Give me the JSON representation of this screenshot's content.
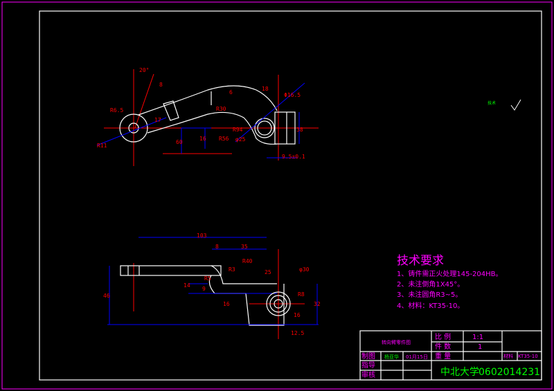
{
  "drawing": {
    "corner_note": "技术",
    "top_view_dims": [
      "20°",
      "8",
      "R6.5",
      "R11",
      "17",
      "R56",
      "R30",
      "6",
      "18",
      "R94",
      "φ25",
      "Φ16.5",
      "38",
      "60",
      "16",
      "9.5±0.1"
    ],
    "front_view_dims": [
      "103",
      "8",
      "35",
      "R40",
      "R3",
      "R5",
      "14",
      "9",
      "46",
      "16",
      "16",
      "32",
      "R8",
      "φ30",
      "25",
      "12.5"
    ]
  },
  "tech_requirements": {
    "title": "技术要求",
    "items": [
      "1、铸件需正火处理145-204HB。",
      "2、未注倒角1X45°。",
      "3、未注圆角R3~5。",
      "4、材料：KT35-10。"
    ]
  },
  "title_block": {
    "part_name": "转向臂零件图",
    "scale_label": "比 例",
    "scale_value": "1:1",
    "quantity_label": "件 数",
    "quantity_value": "1",
    "weight_label": "重 量",
    "drawn_label": "制图",
    "drawn_by": "杨亚华",
    "drawn_date": "01月15日",
    "guide_label": "指导",
    "review_label": "审核",
    "material_label": "材料",
    "material_value": "KT35-10",
    "school": "中北大学",
    "student_id": "0602014231"
  },
  "colors": {
    "frame": "#ffffff",
    "outer_border": "#ff00ff",
    "centerline": "#ff0000",
    "dimension": "#0000ff",
    "text": "#ff00ff",
    "school": "#00ff00"
  }
}
